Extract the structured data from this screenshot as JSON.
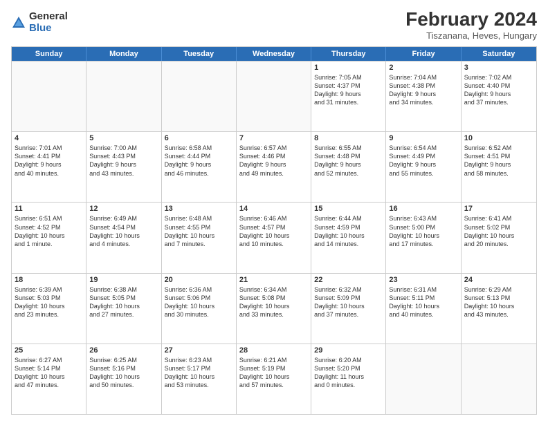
{
  "logo": {
    "general": "General",
    "blue": "Blue"
  },
  "title": "February 2024",
  "subtitle": "Tiszanana, Heves, Hungary",
  "days": [
    "Sunday",
    "Monday",
    "Tuesday",
    "Wednesday",
    "Thursday",
    "Friday",
    "Saturday"
  ],
  "weeks": [
    [
      {
        "day": "",
        "info": ""
      },
      {
        "day": "",
        "info": ""
      },
      {
        "day": "",
        "info": ""
      },
      {
        "day": "",
        "info": ""
      },
      {
        "day": "1",
        "info": "Sunrise: 7:05 AM\nSunset: 4:37 PM\nDaylight: 9 hours\nand 31 minutes."
      },
      {
        "day": "2",
        "info": "Sunrise: 7:04 AM\nSunset: 4:38 PM\nDaylight: 9 hours\nand 34 minutes."
      },
      {
        "day": "3",
        "info": "Sunrise: 7:02 AM\nSunset: 4:40 PM\nDaylight: 9 hours\nand 37 minutes."
      }
    ],
    [
      {
        "day": "4",
        "info": "Sunrise: 7:01 AM\nSunset: 4:41 PM\nDaylight: 9 hours\nand 40 minutes."
      },
      {
        "day": "5",
        "info": "Sunrise: 7:00 AM\nSunset: 4:43 PM\nDaylight: 9 hours\nand 43 minutes."
      },
      {
        "day": "6",
        "info": "Sunrise: 6:58 AM\nSunset: 4:44 PM\nDaylight: 9 hours\nand 46 minutes."
      },
      {
        "day": "7",
        "info": "Sunrise: 6:57 AM\nSunset: 4:46 PM\nDaylight: 9 hours\nand 49 minutes."
      },
      {
        "day": "8",
        "info": "Sunrise: 6:55 AM\nSunset: 4:48 PM\nDaylight: 9 hours\nand 52 minutes."
      },
      {
        "day": "9",
        "info": "Sunrise: 6:54 AM\nSunset: 4:49 PM\nDaylight: 9 hours\nand 55 minutes."
      },
      {
        "day": "10",
        "info": "Sunrise: 6:52 AM\nSunset: 4:51 PM\nDaylight: 9 hours\nand 58 minutes."
      }
    ],
    [
      {
        "day": "11",
        "info": "Sunrise: 6:51 AM\nSunset: 4:52 PM\nDaylight: 10 hours\nand 1 minute."
      },
      {
        "day": "12",
        "info": "Sunrise: 6:49 AM\nSunset: 4:54 PM\nDaylight: 10 hours\nand 4 minutes."
      },
      {
        "day": "13",
        "info": "Sunrise: 6:48 AM\nSunset: 4:55 PM\nDaylight: 10 hours\nand 7 minutes."
      },
      {
        "day": "14",
        "info": "Sunrise: 6:46 AM\nSunset: 4:57 PM\nDaylight: 10 hours\nand 10 minutes."
      },
      {
        "day": "15",
        "info": "Sunrise: 6:44 AM\nSunset: 4:59 PM\nDaylight: 10 hours\nand 14 minutes."
      },
      {
        "day": "16",
        "info": "Sunrise: 6:43 AM\nSunset: 5:00 PM\nDaylight: 10 hours\nand 17 minutes."
      },
      {
        "day": "17",
        "info": "Sunrise: 6:41 AM\nSunset: 5:02 PM\nDaylight: 10 hours\nand 20 minutes."
      }
    ],
    [
      {
        "day": "18",
        "info": "Sunrise: 6:39 AM\nSunset: 5:03 PM\nDaylight: 10 hours\nand 23 minutes."
      },
      {
        "day": "19",
        "info": "Sunrise: 6:38 AM\nSunset: 5:05 PM\nDaylight: 10 hours\nand 27 minutes."
      },
      {
        "day": "20",
        "info": "Sunrise: 6:36 AM\nSunset: 5:06 PM\nDaylight: 10 hours\nand 30 minutes."
      },
      {
        "day": "21",
        "info": "Sunrise: 6:34 AM\nSunset: 5:08 PM\nDaylight: 10 hours\nand 33 minutes."
      },
      {
        "day": "22",
        "info": "Sunrise: 6:32 AM\nSunset: 5:09 PM\nDaylight: 10 hours\nand 37 minutes."
      },
      {
        "day": "23",
        "info": "Sunrise: 6:31 AM\nSunset: 5:11 PM\nDaylight: 10 hours\nand 40 minutes."
      },
      {
        "day": "24",
        "info": "Sunrise: 6:29 AM\nSunset: 5:13 PM\nDaylight: 10 hours\nand 43 minutes."
      }
    ],
    [
      {
        "day": "25",
        "info": "Sunrise: 6:27 AM\nSunset: 5:14 PM\nDaylight: 10 hours\nand 47 minutes."
      },
      {
        "day": "26",
        "info": "Sunrise: 6:25 AM\nSunset: 5:16 PM\nDaylight: 10 hours\nand 50 minutes."
      },
      {
        "day": "27",
        "info": "Sunrise: 6:23 AM\nSunset: 5:17 PM\nDaylight: 10 hours\nand 53 minutes."
      },
      {
        "day": "28",
        "info": "Sunrise: 6:21 AM\nSunset: 5:19 PM\nDaylight: 10 hours\nand 57 minutes."
      },
      {
        "day": "29",
        "info": "Sunrise: 6:20 AM\nSunset: 5:20 PM\nDaylight: 11 hours\nand 0 minutes."
      },
      {
        "day": "",
        "info": ""
      },
      {
        "day": "",
        "info": ""
      }
    ]
  ]
}
